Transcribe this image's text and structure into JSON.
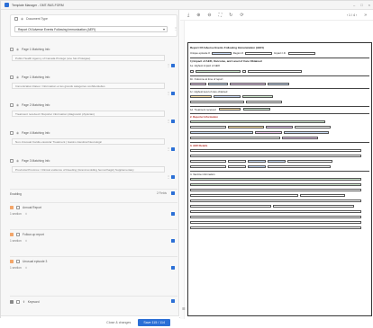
{
  "window": {
    "title": "Template Manager - GMT-RAS-FORM"
  },
  "doc_type": {
    "label": "Document Type",
    "selected": "Report Of Adverse Events Following Immunization (AEFI)"
  },
  "fields": [
    {
      "label": "Page 1 Matching Info",
      "value": "Public Health Agency of Canada Protégé (une fois Protégée)"
    },
    {
      "label": "Page 1 Matching Info",
      "value": "Immunization Dates / Information et les grands catégories confidentielles"
    },
    {
      "label": "Page 2 Matching Info",
      "value": "Treatment received / Reporter information (diagnostic physician)"
    },
    {
      "label": "Page 4 Matching Info",
      "value": "Non-Unusual Cardio-vascular Treatment | Gastro-intestinal Neurologic"
    },
    {
      "label": "Page 3 Matching Info",
      "value": "Provincial Province / Clinical evidence of bleeding (Grand-scolding hemorrhagic) Supplementary"
    }
  ],
  "entries": [
    {
      "label": "Enabling",
      "meta": "2 Fields"
    },
    {
      "label": "Annual Report",
      "meta": "1 section"
    },
    {
      "label": "Follow-up report",
      "meta": "1 section"
    },
    {
      "label": "Unusual episode 3",
      "meta": "1 section"
    },
    {
      "label": "Keyword",
      "meta": ""
    }
  ],
  "footer": {
    "cancel": "Close & changes",
    "save": "Save 115 / 114"
  },
  "viewer": {
    "page": "1 / 4",
    "zoom": "»"
  },
  "form": {
    "title": "Report Of Adverse Events Following Immunization (AEFI)",
    "row1": [
      "Unique episode #",
      "Region #",
      "Impact I.D."
    ],
    "s1": "1) Impact of AEFI, Outcome, and Level of Care Obtained",
    "s1a": "1a. Highest impact of AEFI",
    "s1b": "1b. Outcome at time of report",
    "s1c": "1c. Highest level of care obtained",
    "s1d": "1d. Treatment received",
    "s2": "2. Reporter Information",
    "s3": "3. AEFI Details",
    "s4": "4. Vaccine information"
  }
}
